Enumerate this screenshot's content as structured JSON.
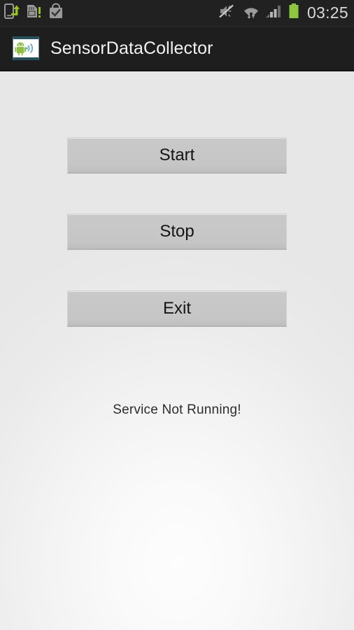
{
  "status_bar": {
    "time": "03:25",
    "left_icons": [
      {
        "name": "usb-file-transfer-icon",
        "label": "USB file transfer"
      },
      {
        "name": "sd-card-warning-icon",
        "label": "SD card alert"
      },
      {
        "name": "play-store-bag-check-icon",
        "label": "App installed"
      }
    ],
    "right_icons": [
      {
        "name": "volume-mute-vibrate-icon",
        "label": "Silent / vibrate"
      },
      {
        "name": "wifi-data-transfer-icon",
        "label": "Wi-Fi connected"
      },
      {
        "name": "cellular-signal-icon",
        "label": "Signal 3 of 4 bars",
        "bars_filled": 3,
        "bars_total": 4
      },
      {
        "name": "battery-full-icon",
        "label": "Battery full",
        "color": "#8dc63f"
      }
    ]
  },
  "action_bar": {
    "title": "SensorDataCollector",
    "icon_name": "android-sensor-app-icon",
    "background_color": "#1e1e1e",
    "title_color": "#f2f2f2"
  },
  "main": {
    "buttons": [
      {
        "label": "Start",
        "name": "start-button"
      },
      {
        "label": "Stop",
        "name": "stop-button"
      },
      {
        "label": "Exit",
        "name": "exit-button"
      }
    ],
    "status_message": "Service Not Running!",
    "button_face_color": "#c6c6c6",
    "background_color": "#ededed"
  }
}
